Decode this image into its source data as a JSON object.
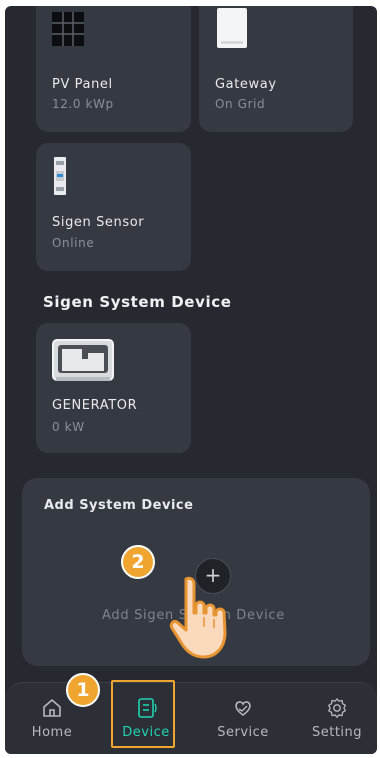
{
  "devices": [
    {
      "name": "PV Panel",
      "status": "12.0 kWp",
      "icon": "pv-panel-icon"
    },
    {
      "name": "Gateway",
      "status": "On Grid",
      "icon": "gateway-icon"
    },
    {
      "name": "Sigen Sensor",
      "status": "Online",
      "icon": "sensor-icon"
    }
  ],
  "system_section": {
    "title": "Sigen System Device",
    "devices": [
      {
        "name": "GENERATOR",
        "status": "0 kW",
        "icon": "generator-icon"
      }
    ]
  },
  "add_panel": {
    "title": "Add System Device",
    "button_symbol": "+",
    "label": "Add Sigen System Device"
  },
  "tabs": [
    {
      "label": "Home",
      "icon": "home-icon",
      "active": false
    },
    {
      "label": "Device",
      "icon": "device-icon",
      "active": true
    },
    {
      "label": "Service",
      "icon": "service-icon",
      "active": false
    },
    {
      "label": "Setting",
      "icon": "setting-icon",
      "active": false
    }
  ],
  "steps": {
    "step1": "1",
    "step2": "2"
  },
  "colors": {
    "accent": "#20d3b3",
    "highlight": "#f0a531",
    "background": "#262a30",
    "card": "#353941"
  }
}
